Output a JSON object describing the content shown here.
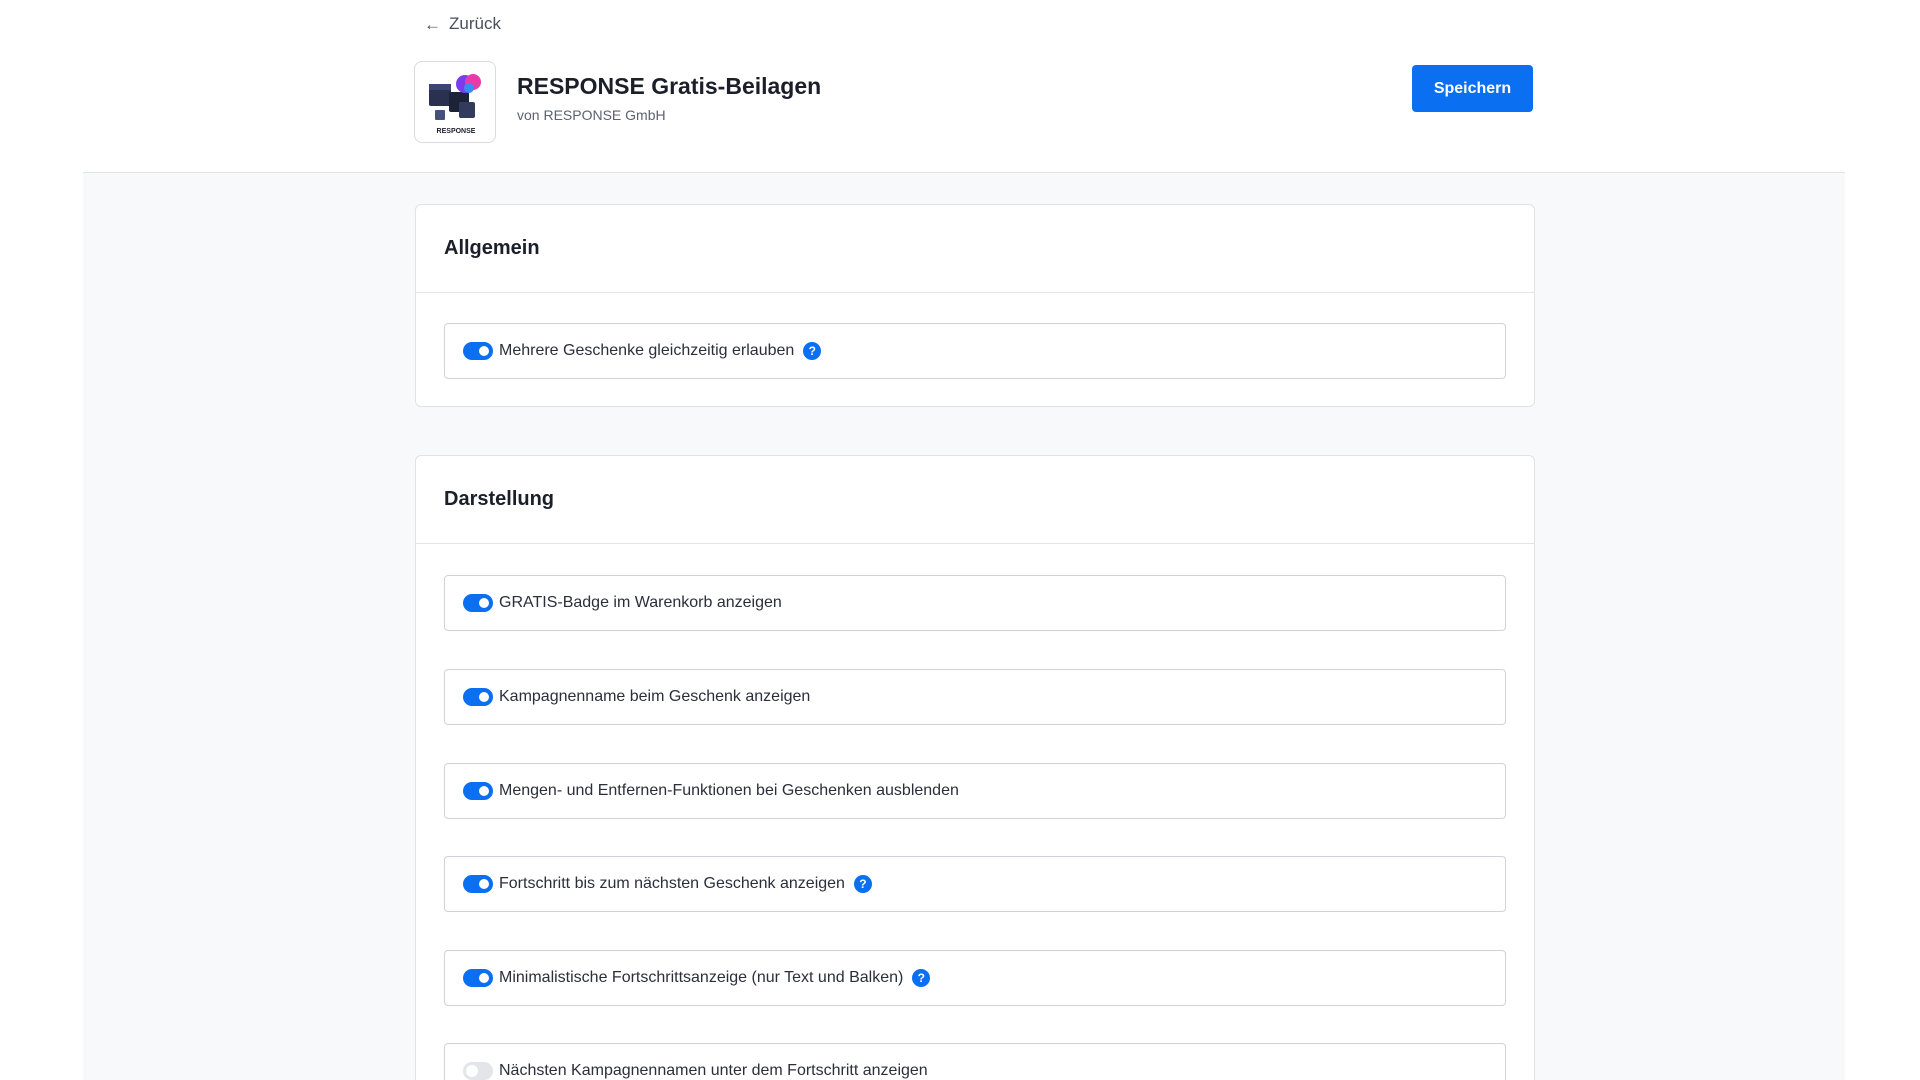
{
  "nav": {
    "back_label": "Zurück"
  },
  "app": {
    "title": "RESPONSE Gratis-Beilagen",
    "vendor": "von RESPONSE GmbH",
    "logo_text": "RESPONSE"
  },
  "toolbar": {
    "save_label": "Speichern"
  },
  "icons": {
    "back": "arrow-left-icon",
    "help": "help-icon",
    "help_glyph": "?"
  },
  "colors": {
    "accent": "#0b6ff2",
    "toggle_off": "#e3e5e9"
  },
  "sections": {
    "general": {
      "title": "Allgemein",
      "options": [
        {
          "label": "Mehrere Geschenke gleichzeitig erlauben",
          "enabled": true,
          "help": true
        }
      ]
    },
    "display": {
      "title": "Darstellung",
      "options": [
        {
          "label": "GRATIS-Badge im Warenkorb anzeigen",
          "enabled": true,
          "help": false
        },
        {
          "label": "Kampagnenname beim Geschenk anzeigen",
          "enabled": true,
          "help": false
        },
        {
          "label": "Mengen- und Entfernen-Funktionen bei Geschenken ausblenden",
          "enabled": true,
          "help": false
        },
        {
          "label": "Fortschritt bis zum nächsten Geschenk anzeigen",
          "enabled": true,
          "help": true
        },
        {
          "label": "Minimalistische Fortschrittsanzeige (nur Text und Balken)",
          "enabled": true,
          "help": true
        },
        {
          "label": "Nächsten Kampagnennamen unter dem Fortschritt anzeigen",
          "enabled": false,
          "help": false
        }
      ]
    }
  }
}
